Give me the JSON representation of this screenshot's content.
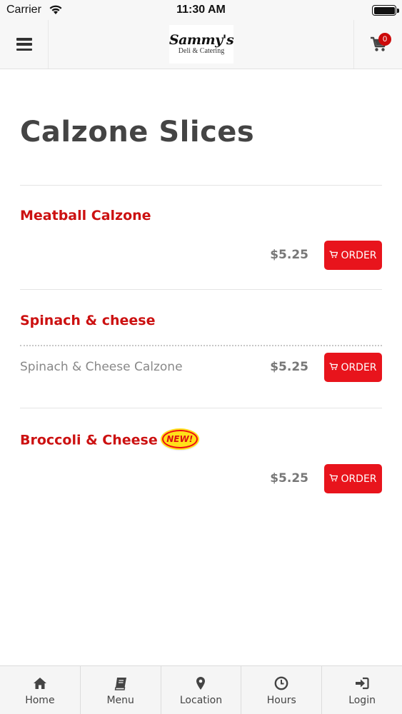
{
  "status_bar": {
    "carrier": "Carrier",
    "time": "11:30 AM"
  },
  "header": {
    "logo_name": "Sammy's",
    "logo_tagline": "Deli & Catering",
    "cart_count": "0"
  },
  "page": {
    "title": "Calzone Slices"
  },
  "items": [
    {
      "name": "Meatball Calzone",
      "variant": "",
      "price": "$5.25",
      "order_label": "ORDER",
      "is_new": false
    },
    {
      "name": "Spinach & cheese",
      "variant": "Spinach & Cheese Calzone",
      "price": "$5.25",
      "order_label": "ORDER",
      "is_new": false
    },
    {
      "name": "Broccoli & Cheese",
      "variant": "",
      "price": "$5.25",
      "order_label": "ORDER",
      "is_new": true,
      "new_label": "NEW!"
    }
  ],
  "tabbar": {
    "tabs": [
      {
        "label": "Home",
        "icon": "home-icon"
      },
      {
        "label": "Menu",
        "icon": "book-icon"
      },
      {
        "label": "Location",
        "icon": "map-marker-icon"
      },
      {
        "label": "Hours",
        "icon": "clock-icon"
      },
      {
        "label": "Login",
        "icon": "sign-in-icon"
      }
    ]
  },
  "colors": {
    "accent": "#e8141c",
    "item_name": "#cc1111",
    "title": "#444444",
    "price": "#777777"
  }
}
